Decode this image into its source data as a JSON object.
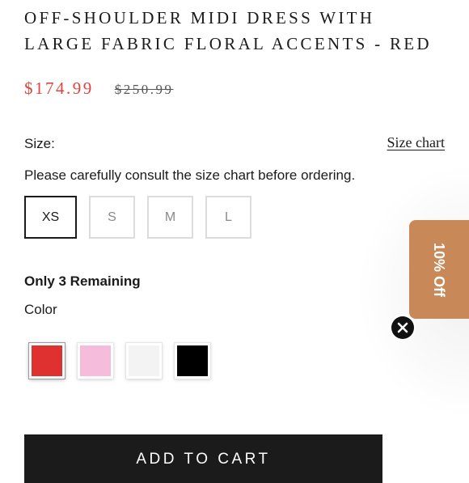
{
  "product": {
    "title_line1": "OFF-SHOULDER MIDI DRESS WITH",
    "title_line2": "LARGE FABRIC FLORAL ACCENTS - RED",
    "price": "$174.99",
    "compare_price": "$250.99"
  },
  "size": {
    "label": "Size:",
    "chart_link": "Size chart",
    "note": "Please carefully consult the size chart before ordering.",
    "options": [
      "XS",
      "S",
      "M",
      "L"
    ],
    "selected": "XS"
  },
  "stock": {
    "remaining_text": "Only 3 Remaining"
  },
  "color": {
    "label": "Color",
    "swatches": [
      {
        "name": "red",
        "hex": "#e03131",
        "selected": true
      },
      {
        "name": "pink",
        "hex": "#f5bcdc",
        "selected": false
      },
      {
        "name": "white",
        "hex": "#f3f3f3",
        "selected": false
      },
      {
        "name": "black",
        "hex": "#000000",
        "selected": false
      }
    ]
  },
  "cart": {
    "add_label": "ADD TO CART"
  },
  "promo": {
    "label": "10% Off",
    "bg": "#c98858",
    "close_icon": "close-icon"
  },
  "colors": {
    "accent_price": "#e0443c",
    "text": "#1c1b1b"
  }
}
